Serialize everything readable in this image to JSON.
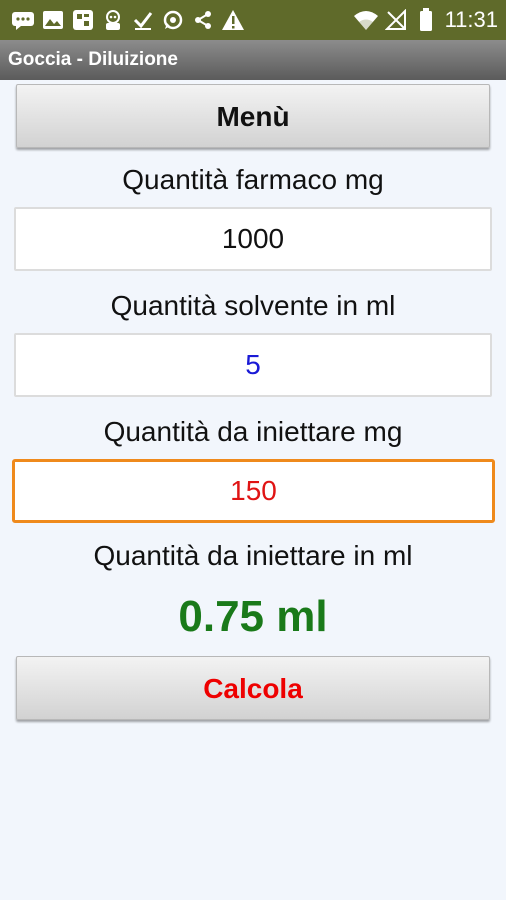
{
  "status_bar": {
    "time": "11:31",
    "icons": [
      "message-icon",
      "gallery-icon",
      "app-icon",
      "robot-icon",
      "check-icon",
      "whatsapp-icon",
      "share-icon",
      "warning-icon",
      "wifi-icon",
      "no-signal-icon",
      "battery-icon"
    ]
  },
  "app": {
    "title": "Goccia - Diluizione"
  },
  "menu_button": {
    "label": "Menù"
  },
  "fields": {
    "drug_amount": {
      "label": "Quantità farmaco mg",
      "value": "1000",
      "color": "#111111"
    },
    "solvent_amount": {
      "label": "Quantità solvente in ml",
      "value": "5",
      "color": "#1a1ad6"
    },
    "inject_mg": {
      "label": "Quantità da iniettare mg",
      "value": "150",
      "color": "#e01414"
    }
  },
  "result": {
    "label": "Quantità da iniettare in ml",
    "value": "0.75 ml",
    "color": "#1a7a1a"
  },
  "calculate_button": {
    "label": "Calcola",
    "color": "#ee0000"
  },
  "colors": {
    "status_bar": "#5f6a2a",
    "background": "#f2f6fc",
    "focus_border": "#ef8a1c"
  }
}
